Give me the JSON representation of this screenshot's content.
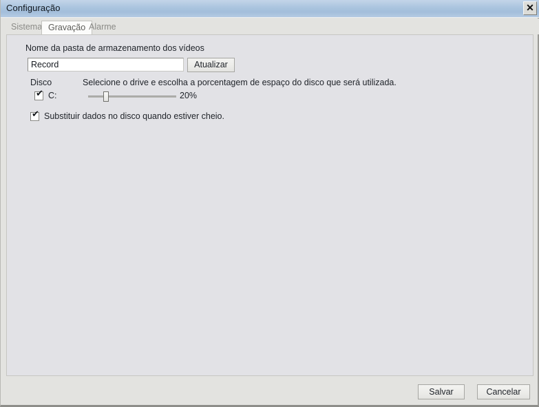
{
  "window": {
    "title": "Configuração",
    "close_icon": "close-icon",
    "close_glyph": "✕"
  },
  "tabs": [
    {
      "label": "Sistema",
      "active": false
    },
    {
      "label": "Gravação",
      "active": true
    },
    {
      "label": "Alarme",
      "active": false
    }
  ],
  "recording_tab": {
    "folder_label": "Nome da pasta de armazenamento dos vídeos",
    "folder_value": "Record",
    "folder_placeholder": "",
    "update_button": "Atualizar",
    "disk_label": "Disco",
    "disk_hint": "Selecione o drive e escolha a porcentagem de espaço do disco que será utilizada.",
    "disk_checkbox": {
      "label": "C:",
      "checked": true,
      "check_glyph": "✔"
    },
    "slider": {
      "value": 20,
      "min": 0,
      "max": 100,
      "value_label": "20%"
    },
    "overwrite_checkbox": {
      "label": "Substituir dados no disco quando estiver cheio.",
      "checked": true,
      "check_glyph": "✔"
    }
  },
  "footer": {
    "save_label": "Salvar",
    "cancel_label": "Cancelar"
  },
  "colors": {
    "titlebar": "#aac4de",
    "window_bg": "#e3e3e0",
    "panel_bg": "#e2e2e6",
    "text": "#20242a",
    "tab_inactive_text": "#8b8b87"
  }
}
